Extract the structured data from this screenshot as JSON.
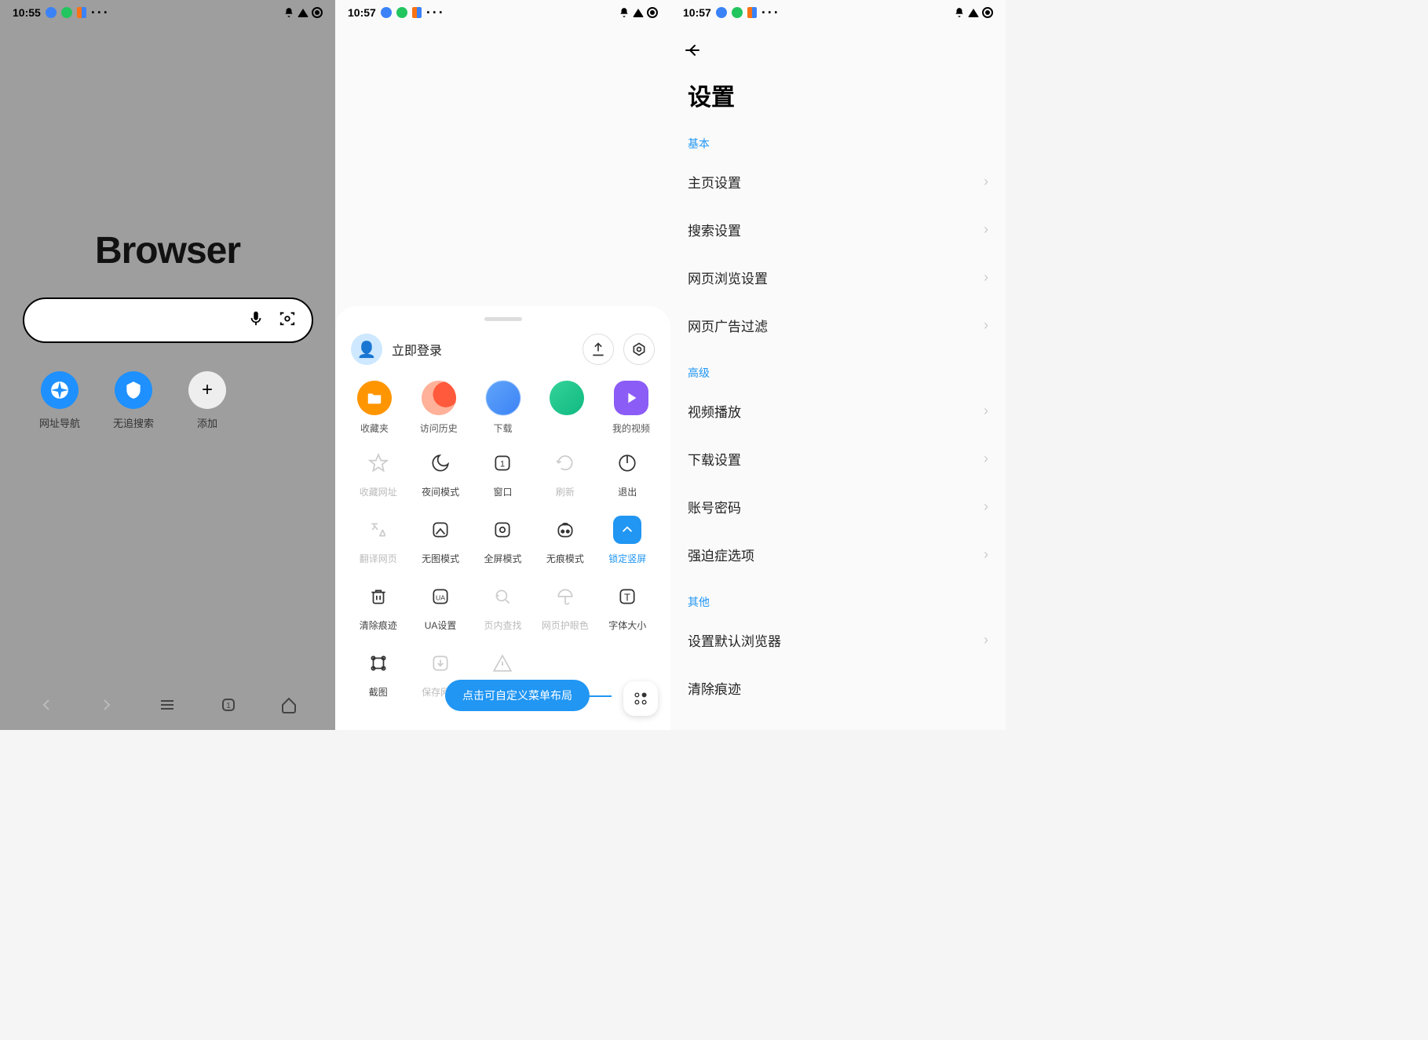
{
  "status": {
    "time1": "10:55",
    "time2": "10:57",
    "time3": "10:57"
  },
  "phone1": {
    "title": "Browser",
    "shortcuts": [
      {
        "label": "网址导航"
      },
      {
        "label": "无追搜索"
      },
      {
        "label": "添加"
      }
    ]
  },
  "phone2": {
    "login": "立即登录",
    "quick": [
      {
        "label": "收藏夹"
      },
      {
        "label": "访问历史"
      },
      {
        "label": "下载"
      },
      {
        "label": ""
      },
      {
        "label": "我的视频"
      }
    ],
    "tools": [
      {
        "label": "收藏网址",
        "state": "disabled"
      },
      {
        "label": "夜间模式",
        "state": ""
      },
      {
        "label": "窗口",
        "state": ""
      },
      {
        "label": "刷新",
        "state": "disabled"
      },
      {
        "label": "退出",
        "state": ""
      },
      {
        "label": "翻译网页",
        "state": "disabled"
      },
      {
        "label": "无图模式",
        "state": ""
      },
      {
        "label": "全屏模式",
        "state": ""
      },
      {
        "label": "无痕模式",
        "state": ""
      },
      {
        "label": "锁定竖屏",
        "state": "active"
      },
      {
        "label": "清除痕迹",
        "state": ""
      },
      {
        "label": "UA设置",
        "state": ""
      },
      {
        "label": "页内查找",
        "state": "disabled"
      },
      {
        "label": "网页护眼色",
        "state": "disabled"
      },
      {
        "label": "字体大小",
        "state": ""
      },
      {
        "label": "截图",
        "state": ""
      },
      {
        "label": "保存网页",
        "state": "disabled"
      },
      {
        "label": "举报",
        "state": "disabled"
      }
    ],
    "tip": "点击可自定义菜单布局"
  },
  "phone3": {
    "title": "设置",
    "sections": {
      "basic": {
        "label": "基本",
        "items": [
          "主页设置",
          "搜索设置",
          "网页浏览设置",
          "网页广告过滤"
        ]
      },
      "advanced": {
        "label": "高级",
        "items": [
          "视频播放",
          "下载设置",
          "账号密码",
          "强迫症选项"
        ]
      },
      "other": {
        "label": "其他",
        "items": [
          "设置默认浏览器",
          "清除痕迹"
        ]
      }
    }
  }
}
